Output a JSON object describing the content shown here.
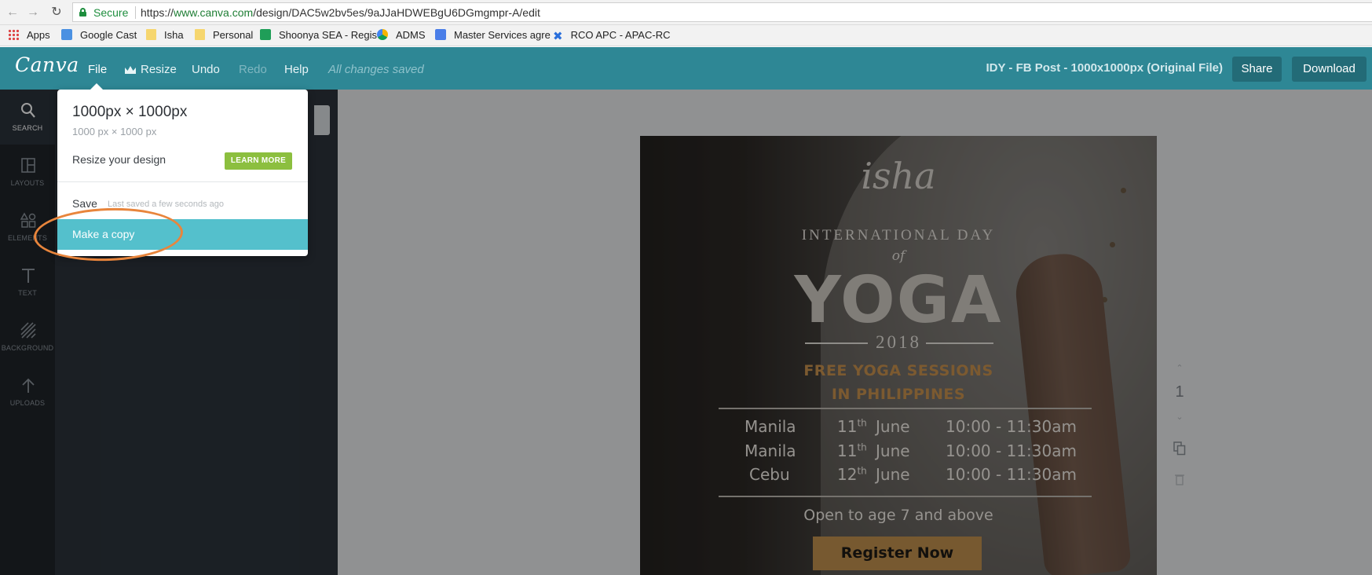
{
  "browser": {
    "secure_label": "Secure",
    "url_prefix": "https://",
    "url_host": "www.canva.com",
    "url_path": "/design/DAC5w2bv5es/9aJJaHDWEBgU6DGmgmpr-A/edit",
    "bookmarks": [
      {
        "label": "Apps",
        "icon": "apps-grid-icon"
      },
      {
        "label": "Google Cast",
        "icon": "cast-icon"
      },
      {
        "label": "Isha",
        "icon": "folder-icon"
      },
      {
        "label": "Personal",
        "icon": "folder-icon"
      },
      {
        "label": "Shoonya SEA - Regis",
        "icon": "sheets-icon"
      },
      {
        "label": "ADMS",
        "icon": "drive-icon"
      },
      {
        "label": "Master Services agre",
        "icon": "docs-icon"
      },
      {
        "label": "RCO APC - APAC-RC",
        "icon": "x-icon"
      }
    ]
  },
  "appbar": {
    "logo": "Canva",
    "menu": {
      "file": "File",
      "resize": "Resize",
      "undo": "Undo",
      "redo": "Redo",
      "help": "Help",
      "status": "All changes saved"
    },
    "document_title": "IDY - FB Post - 1000x1000px (Original File)",
    "share": "Share",
    "download": "Download",
    "accent": "#2e8795"
  },
  "rail": [
    {
      "label": "SEARCH",
      "icon": "search-icon",
      "active": true
    },
    {
      "label": "LAYOUTS",
      "icon": "layouts-icon"
    },
    {
      "label": "ELEMENTS",
      "icon": "elements-icon"
    },
    {
      "label": "TEXT",
      "icon": "text-icon"
    },
    {
      "label": "BACKGROUND",
      "icon": "background-icon"
    },
    {
      "label": "UPLOADS",
      "icon": "upload-icon"
    }
  ],
  "file_menu": {
    "size_title": "1000px × 1000px",
    "size_sub": "1000 px × 1000 px",
    "resize_label": "Resize your design",
    "learn_more": "LEARN MORE",
    "save": "Save",
    "saved_note": "Last saved a few seconds ago",
    "make_copy": "Make a copy"
  },
  "design": {
    "brand": "isha",
    "line1": "INTERNATIONAL DAY",
    "line2": "of",
    "headline": "YOGA",
    "year": "2018",
    "free_line1": "FREE YOGA SESSIONS",
    "free_line2": "IN PHILIPPINES",
    "sessions": [
      {
        "city": "Manila",
        "day": "11",
        "suffix": "th",
        "month": "June",
        "time": "10:00 - 11:30am"
      },
      {
        "city": "Manila",
        "day": "11",
        "suffix": "th",
        "month": "June",
        "time": "10:00 - 11:30am"
      },
      {
        "city": "Cebu",
        "day": "12",
        "suffix": "th",
        "month": "June",
        "time": "10:00 - 11:30am"
      }
    ],
    "open_to": "Open to age 7 and above",
    "cta": "Register Now",
    "cta_color": "#c0904e",
    "accent_text_color": "#c9924e"
  },
  "page_number": "1"
}
